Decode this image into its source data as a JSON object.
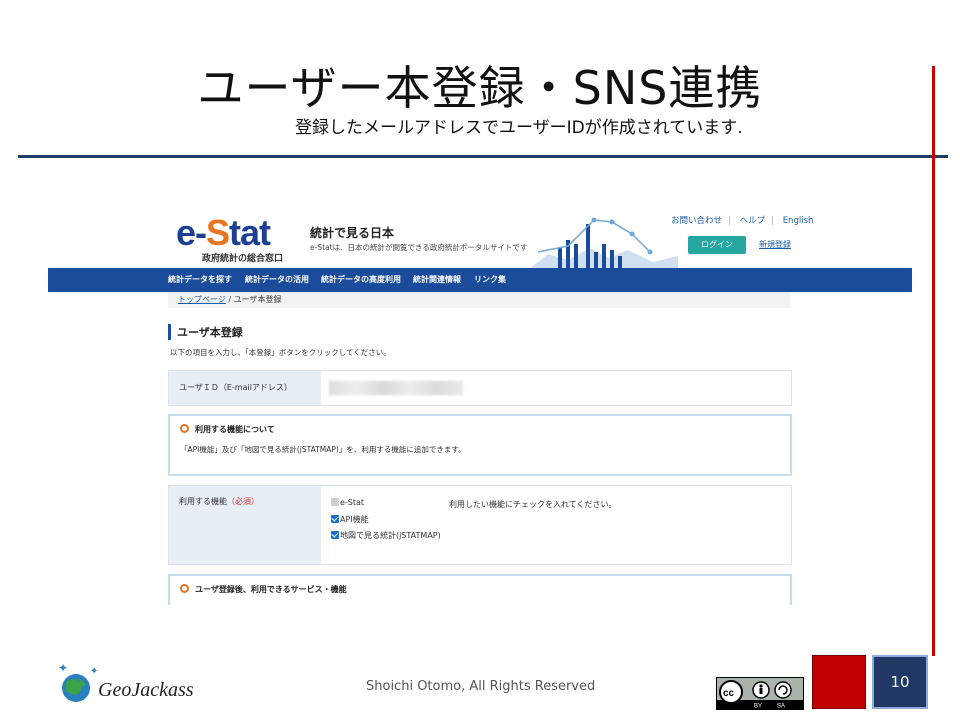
{
  "slide": {
    "title": "ユーザー本登録・SNS連携",
    "footer_credit": "Shoichi Otomo, All Rights Reserved",
    "page_number": "10",
    "footer_logo_text": "GeoJackass",
    "license_badge": "CC BY SA"
  },
  "callout": "登録したメールアドレスでユーザーIDが作成されています.",
  "estat": {
    "logo": "e-Stat",
    "logo_sub": "政府統計の総合窓口",
    "tagline": "統計で見る日本",
    "description": "e-Statは、日本の統計が閲覧できる政府統計ポータルサイトです",
    "top_links": [
      "お問い合わせ",
      "ヘルプ",
      "English"
    ],
    "login_button": "ログイン",
    "register_link": "新規登録",
    "nav": [
      "統計データを探す",
      "統計データの活用",
      "統計データの高度利用",
      "統計関連情報",
      "リンク集"
    ],
    "breadcrumb": {
      "home": "トップページ",
      "current": "ユーザ本登録"
    },
    "page_heading": "ユーザ本登録",
    "instruction": "以下の項目を入力し、「本登録」ボタンをクリックしてください。",
    "user_id_label": "ユーザＩＤ（E-mailアドレス）",
    "features_box": {
      "title": "利用する機能について",
      "body": "「API機能」及び「地図で見る統計(jSTATMAP)」を、利用する機能に追加できます。"
    },
    "features_field": {
      "label": "利用する機能",
      "required": "（必須）",
      "note": "利用したい機能にチェックを入れてください。",
      "options": [
        {
          "label": "e-Stat",
          "checked": true,
          "disabled": true
        },
        {
          "label": "API機能",
          "checked": true,
          "disabled": false
        },
        {
          "label": "地図で見る統計(jSTATMAP)",
          "checked": true,
          "disabled": false
        }
      ]
    },
    "services_box_title": "ユーザ登録後、利用できるサービス・機能"
  },
  "colors": {
    "title_rule": "#1f3f63",
    "accent_red": "#cc0000",
    "estat_nav": "#1b4b9b",
    "login_teal": "#26a6a0",
    "page_box": "#1f3864"
  }
}
